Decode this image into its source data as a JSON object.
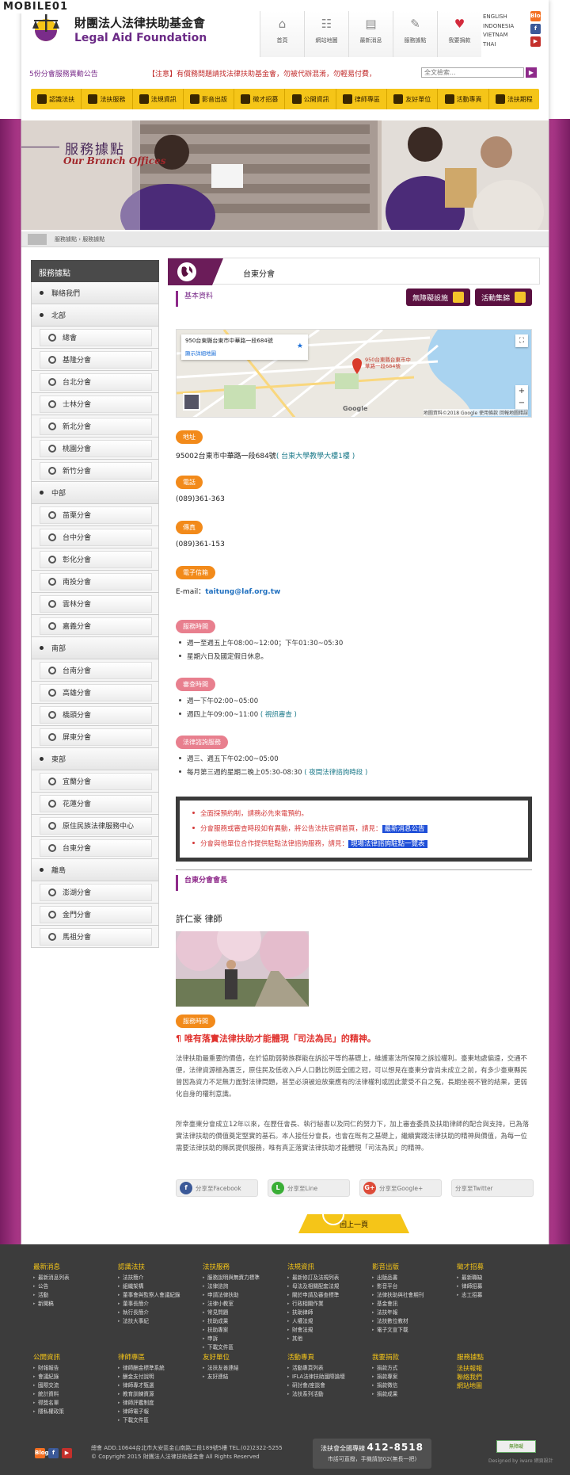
{
  "site_watermark": "MOBILE01",
  "header": {
    "org_zh": "財團法人法律扶助基金會",
    "org_en": "Legal Aid Foundation",
    "top_nav": [
      {
        "label": "首頁",
        "icon": "home-icon"
      },
      {
        "label": "網站地圖",
        "icon": "sitemap-icon"
      },
      {
        "label": "最新消息",
        "icon": "news-icon"
      },
      {
        "label": "服務據點",
        "icon": "feather-icon"
      },
      {
        "label": "我要捐款",
        "icon": "heart-icon"
      }
    ],
    "languages": [
      "ENGLISH",
      "INDONESIA",
      "VIETNAM",
      "THAI"
    ],
    "social": [
      {
        "label": "Blog",
        "icon": "blog-icon"
      },
      {
        "label": "f",
        "icon": "facebook-icon"
      },
      {
        "label": "▶",
        "icon": "youtube-icon"
      }
    ]
  },
  "notice": {
    "label": "5份分會服務異動公告",
    "text": "【注意】有償務問題請找法律扶助基金會，勿被代辦混淆，勿輕易付費，",
    "search_placeholder": "全文檢索...",
    "search_btn": "▶"
  },
  "main_nav": [
    "認識法扶",
    "法扶服務",
    "法規資訊",
    "影音出版",
    "徵才招募",
    "公開資訊",
    "律師專區",
    "友好單位",
    "活動專頁",
    "法扶期程"
  ],
  "banner": {
    "title_zh": "服務據點",
    "title_en": "Our Branch Offices"
  },
  "breadcrumb": "服務據點 › 服務據點",
  "sidebar": {
    "title": "服務據點",
    "items": [
      {
        "label": "聯絡我們",
        "level": 1
      },
      {
        "label": "北部",
        "level": 1
      },
      {
        "label": "總會",
        "level": 2
      },
      {
        "label": "基隆分會",
        "level": 2
      },
      {
        "label": "台北分會",
        "level": 2
      },
      {
        "label": "士林分會",
        "level": 2
      },
      {
        "label": "新北分會",
        "level": 2
      },
      {
        "label": "桃園分會",
        "level": 2
      },
      {
        "label": "新竹分會",
        "level": 2
      },
      {
        "label": "中部",
        "level": 1
      },
      {
        "label": "苗栗分會",
        "level": 2
      },
      {
        "label": "台中分會",
        "level": 2
      },
      {
        "label": "彰化分會",
        "level": 2
      },
      {
        "label": "南投分會",
        "level": 2
      },
      {
        "label": "雲林分會",
        "level": 2
      },
      {
        "label": "嘉義分會",
        "level": 2
      },
      {
        "label": "南部",
        "level": 1
      },
      {
        "label": "台南分會",
        "level": 2
      },
      {
        "label": "高雄分會",
        "level": 2
      },
      {
        "label": "橋頭分會",
        "level": 2
      },
      {
        "label": "屏東分會",
        "level": 2
      },
      {
        "label": "東部",
        "level": 1
      },
      {
        "label": "宜蘭分會",
        "level": 2
      },
      {
        "label": "花蓮分會",
        "level": 2
      },
      {
        "label": "原住民族法律服務中心",
        "level": 2
      },
      {
        "label": "台東分會",
        "level": 2
      },
      {
        "label": "離島",
        "level": 1
      },
      {
        "label": "澎湖分會",
        "level": 2
      },
      {
        "label": "金門分會",
        "level": 2
      },
      {
        "label": "馬祖分會",
        "level": 2
      }
    ]
  },
  "content": {
    "title": "台東分會",
    "section_basic": "基本資料",
    "btn_accessible": "無障礙設施",
    "btn_album": "活動集錦",
    "map": {
      "address_card": "950台東縣台東市中華路一段684號",
      "enlarge": "顯示詳細地圖",
      "pin_label": "950台東縣台東市中華路一段684號",
      "google": "Google",
      "footer": "地圖資料©2018 Google  使用條款  回報地圖錯誤",
      "zoom_in": "+",
      "zoom_out": "−"
    },
    "address_label": "地址",
    "address": "95002台東市中華路一段684號",
    "address_note": "( 台東大學教學大樓1樓 )",
    "phone_label": "電話",
    "phone": "(089)361-363",
    "fax_label": "傳真",
    "fax": "(089)361-153",
    "email_label": "電子信箱",
    "email_prefix": "E-mail：",
    "email": "taitung@laf.org.tw",
    "hours_label": "服務時間",
    "hours": [
      "週一至週五上午08:00~12:00；下午01:30~05:30",
      "星期六日及國定假日休息。"
    ],
    "review_label": "審查時間",
    "review": [
      "週一下午02:00~05:00",
      "週四上午09:00~11:00"
    ],
    "review_link": "( 視訊審查 )",
    "consult_label": "法律諮詢服務",
    "consult": [
      "週三、週五下午02:00~05:00",
      "每月第三週的星期二晚上05:30-08:30"
    ],
    "consult_link": "( 夜間法律諮詢時段 )",
    "notes": [
      {
        "text": "全面採預約制，請務必先來電預約。",
        "link": ""
      },
      {
        "text": "分會服務或審查時段如有異動，將公告法扶官網首頁，請見：",
        "link": "最新消息公告"
      },
      {
        "text": "分會與他單位合作提供駐點法律諮詢服務，請見：",
        "link": "現場法律諮詢駐點一覽表"
      }
    ],
    "chief_section": "台東分會會長",
    "chief_name": "許仁豪 律師",
    "chief_tag": "服務時間",
    "motto": "¶ 唯有落實法律扶助才能體現「司法為民」的精神。",
    "para1": "法律扶助最重要的價值，在於協助弱勢族群能在訴訟平等的基礎上，維護憲法所保障之訴訟權利。臺東地處偏遠，交通不便，法律資源極為匱乏，原住民及低收入戶人口數比例居全國之冠，可以想見在臺東分會尚未成立之前，有多少臺東縣民曾因為資力不足無力面對法律問題，甚至必須被迫放棄應有的法律權利或因此蒙受不白之冤，長期坐視不管的結果，更弱化自身的權利意識。",
    "para2": "所幸臺東分會成立12年以來，在歷任會長、執行秘書以及同仁的努力下，加上審查委員及扶助律師的配合與支持，已為落實法律扶助的價值奠定堅實的基石。本人接任分會長，也會在既有之基礎上，繼續實踐法律扶助的精神與價值，為每一位需要法律扶助的縣民提供服務，唯有真正落實法律扶助才能體現「司法為民」的精神。",
    "share": [
      {
        "label": "分享至Facebook",
        "mark": "f",
        "color": "#3b5998"
      },
      {
        "label": "分享至Line",
        "mark": "L",
        "color": "#3aae36"
      },
      {
        "label": "分享至Google+",
        "mark": "G+",
        "color": "#dd4b39"
      },
      {
        "label": "分享至Twitter",
        "mark": "",
        "color": "#eeeeee"
      }
    ],
    "back_top": "回上一頁"
  },
  "footer": {
    "cols": [
      {
        "title": "最新消息",
        "items": [
          "最新消息列表",
          "公告",
          "活動",
          "新聞稿"
        ]
      },
      {
        "title": "認識法扶",
        "items": [
          "法扶簡介",
          "組織架構",
          "董事會與監察人會議紀錄",
          "董事長簡介",
          "執行長簡介",
          "法扶大事紀"
        ]
      },
      {
        "title": "法扶服務",
        "items": [
          "服務說明與無資力標準",
          "法律諮詢",
          "申請法律扶助",
          "法律小教室",
          "常見問題",
          "扶助成果",
          "扶助專案",
          "申訴",
          "下載文件區"
        ]
      },
      {
        "title": "法規資訊",
        "items": [
          "最新修訂及法規列表",
          "母法及相關配套法規",
          "關於申請及審查標準",
          "行政相關作業",
          "扶助律師",
          "人權法規",
          "財會法規",
          "其他"
        ]
      },
      {
        "title": "影音出版",
        "items": [
          "出版品書",
          "影音平台",
          "法律扶助與社會期刊",
          "基金會訊",
          "法扶年報",
          "法扶數位教材",
          "電子文宣下載"
        ]
      },
      {
        "title": "徵才招募",
        "items": [
          "最新職缺",
          "律師招募",
          "志工招募"
        ]
      },
      {
        "title": "公開資訊",
        "items": [
          "財報報告",
          "會議紀錄",
          "國際交流",
          "統計資料",
          "得獎名單",
          "隱私權政策"
        ]
      },
      {
        "title": "律師專區",
        "items": [
          "律師酬金標準系統",
          "酬金支付說明",
          "律師專才甄選",
          "教育訓練資源",
          "律師評鑑制度",
          "律師電子報",
          "下載文件區"
        ]
      },
      {
        "title": "友好單位",
        "items": [
          "法扶友善連結",
          "友好連結"
        ]
      },
      {
        "title": "活動專頁",
        "items": [
          "活動專頁列表",
          "IFLA法律扶助國際論壇",
          "研討會/座談會",
          "法扶系列活動"
        ]
      },
      {
        "title": "我要捐款",
        "items": [
          "捐款方式",
          "捐款專案",
          "捐款徵信",
          "捐款成果"
        ]
      },
      {
        "title": "服務據點",
        "items": [
          "法扶報報",
          "聯絡我們",
          "網站地圖"
        ]
      }
    ],
    "address_line": "總會 ADD.10644台北市大安區金山南路二段189號5樓  TEL.(02)2322-5255",
    "copyright": "© Copyright 2015 財團法人法律扶助基金會 All Rights Reserved",
    "hotline_label": "法扶會全國專線",
    "hotline": "412-8518",
    "hotline_note": "市話可直撥，手機請加02(無長一把)",
    "badge": "無障礙",
    "designer": "Designed by iware 網頁設計",
    "social": [
      "Blog",
      "f",
      "▶"
    ]
  }
}
